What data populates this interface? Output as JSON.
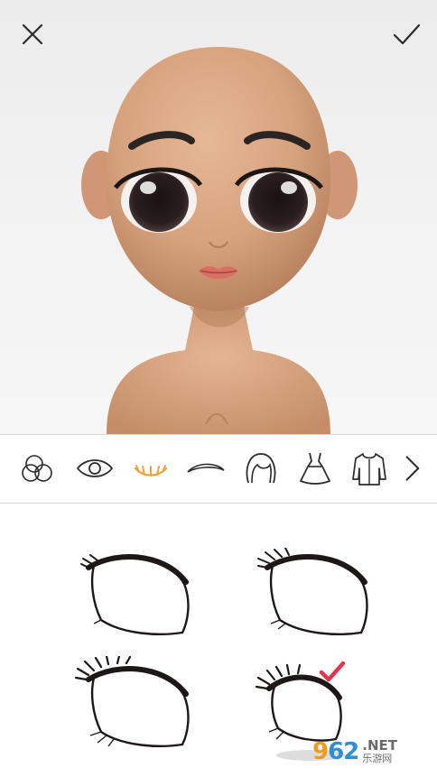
{
  "header": {
    "close_icon": "close-x-icon",
    "confirm_icon": "checkmark-icon"
  },
  "colors": {
    "accent": "#f2a23a",
    "tool_icon": "#2b2b2b",
    "selected_check": "#e5364f",
    "skin": "#d9a885",
    "preview_bg": "#efefef"
  },
  "toolbar": {
    "tools": [
      {
        "name": "skin-tone",
        "icon": "circles-icon",
        "selected": false
      },
      {
        "name": "eyes",
        "icon": "eye-icon",
        "selected": false
      },
      {
        "name": "eyelashes",
        "icon": "eyelashes-icon",
        "selected": true
      },
      {
        "name": "eyebrows",
        "icon": "eyebrow-icon",
        "selected": false
      },
      {
        "name": "hair",
        "icon": "hair-icon",
        "selected": false
      },
      {
        "name": "dress",
        "icon": "dress-icon",
        "selected": false
      },
      {
        "name": "top",
        "icon": "hoodie-icon",
        "selected": false
      }
    ],
    "next_icon": "chevron-right-icon"
  },
  "options": {
    "items": [
      {
        "id": "lash-1",
        "selected": false
      },
      {
        "id": "lash-2",
        "selected": false
      },
      {
        "id": "lash-3",
        "selected": false
      },
      {
        "id": "lash-4",
        "selected": true
      }
    ]
  },
  "watermark": {
    "logo_orange": "9",
    "logo_blue": "62",
    "net": ".NET",
    "cn": "乐游网"
  }
}
